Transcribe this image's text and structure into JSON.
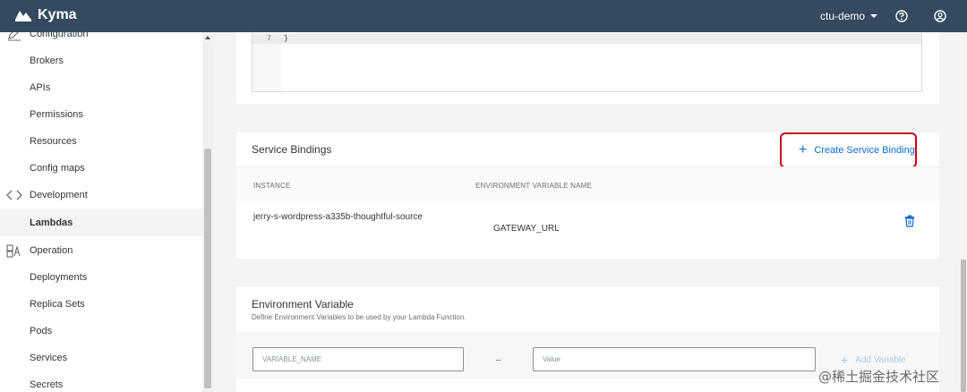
{
  "app": {
    "title": "Kyma"
  },
  "header": {
    "namespace": "ctu-demo"
  },
  "sidebar": {
    "items": [
      {
        "label": "Configuration",
        "type": "category"
      },
      {
        "label": "Brokers"
      },
      {
        "label": "APIs"
      },
      {
        "label": "Permissions"
      },
      {
        "label": "Resources"
      },
      {
        "label": "Config maps"
      },
      {
        "label": "Development",
        "type": "category"
      },
      {
        "label": "Lambdas",
        "active": true
      },
      {
        "label": "Operation",
        "type": "category"
      },
      {
        "label": "Deployments"
      },
      {
        "label": "Replica Sets"
      },
      {
        "label": "Pods"
      },
      {
        "label": "Services"
      },
      {
        "label": "Secrets"
      }
    ]
  },
  "editor": {
    "line_number": "7",
    "line_code": "}"
  },
  "service_bindings": {
    "title": "Service Bindings",
    "create_label": "Create Service Binding",
    "columns": [
      "INSTANCE",
      "ENVIRONMENT VARIABLE NAME"
    ],
    "rows": [
      {
        "instance": "jerry-s-wordpress-a335b-thoughtful-source",
        "env_var": "GATEWAY_URL"
      }
    ]
  },
  "environment_variable": {
    "title": "Environment Variable",
    "subtitle": "Define Environment Variables to be used by your Lambda Function.",
    "name_placeholder": "VARIABLE_NAME",
    "separator": "–",
    "value_placeholder": "Value",
    "add_label": "Add Variable"
  },
  "watermark": "@稀土掘金技术社区",
  "colors": {
    "header": "#354a5f",
    "accent": "#0a6ed1",
    "highlight": "#d0021b"
  }
}
